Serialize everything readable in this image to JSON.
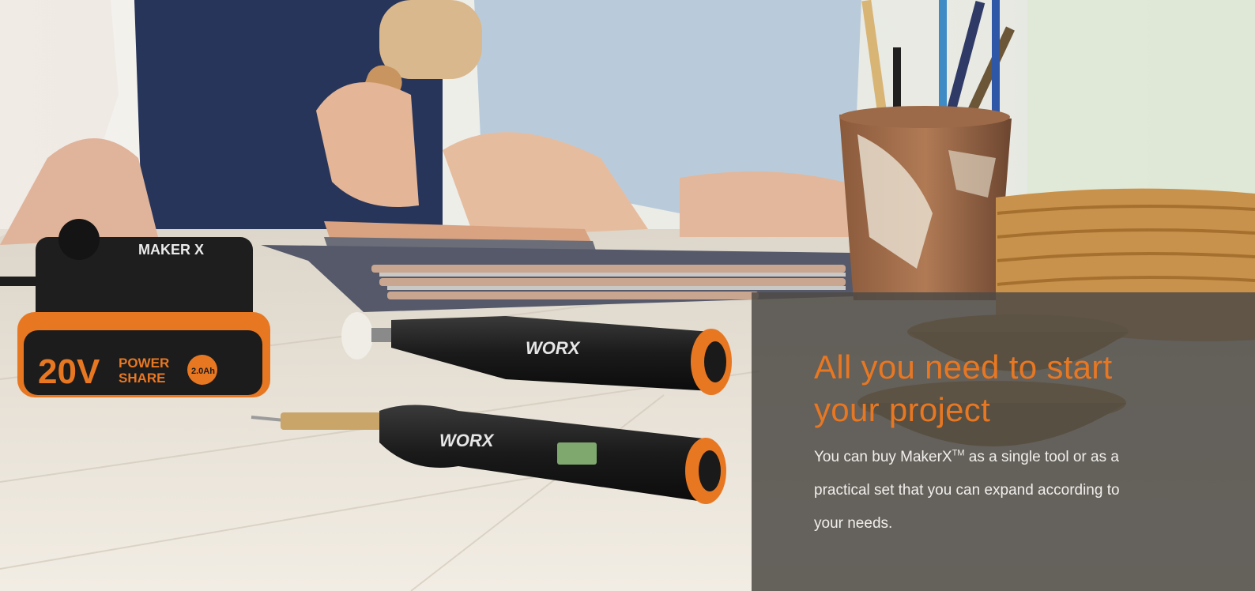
{
  "hero": {
    "image_label": "Worx MakerX tools on a workbench",
    "battery_brand": "MAKER X",
    "battery_voltage": "20V",
    "battery_line1": "POWER",
    "battery_line2": "SHARE",
    "battery_capacity": "2.0Ah",
    "tool_brand": "WORX"
  },
  "overlay": {
    "title": "All you need to start your project",
    "body_before": "You can buy MakerX",
    "trademark": "TM",
    "body_after": " as a single tool or as a practical set that you can expand according to your needs."
  },
  "colors": {
    "accent": "#e87722",
    "overlay_bg": "#4e4a46",
    "overlay_text": "#f1efec"
  }
}
